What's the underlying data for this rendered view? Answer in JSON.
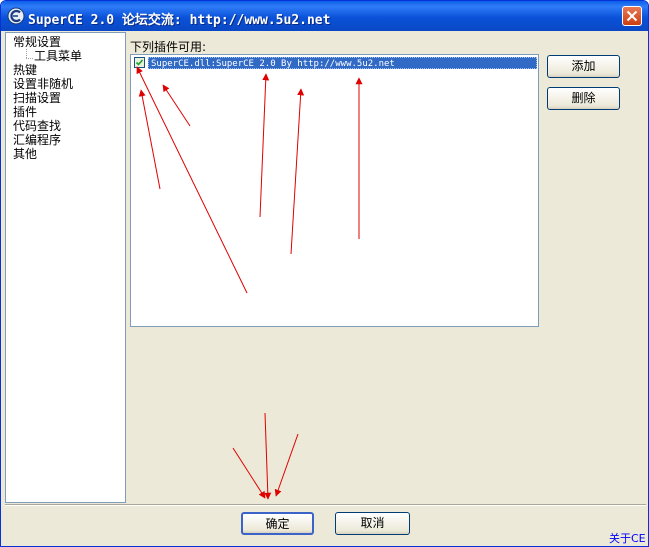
{
  "window": {
    "title": "SuperCE 2.0 论坛交流: http://www.5u2.net",
    "close_icon": "close-icon",
    "app_icon": "superce-logo-icon"
  },
  "sidebar": {
    "items": [
      {
        "label": "常规设置",
        "level": 0
      },
      {
        "label": "工具菜单",
        "level": 1
      },
      {
        "label": "热键",
        "level": 0
      },
      {
        "label": "设置非随机",
        "level": 0
      },
      {
        "label": "扫描设置",
        "level": 0
      },
      {
        "label": "插件",
        "level": 0
      },
      {
        "label": "代码查找",
        "level": 0
      },
      {
        "label": "汇编程序",
        "level": 0
      },
      {
        "label": "其他",
        "level": 0
      }
    ]
  },
  "plugins": {
    "label": "下列插件可用:",
    "items": [
      {
        "text": "SuperCE.dll:SuperCE 2.0 By http://www.5u2.net",
        "checked": true,
        "selected": true
      }
    ],
    "add_label": "添加",
    "remove_label": "删除"
  },
  "footer": {
    "ok_label": "确定",
    "cancel_label": "取消",
    "about_label": "关于CE"
  },
  "colors": {
    "titlebar": "#0a52d9",
    "selection": "#316ac5",
    "annotation_arrow": "#e00000",
    "link": "#0000ff"
  }
}
